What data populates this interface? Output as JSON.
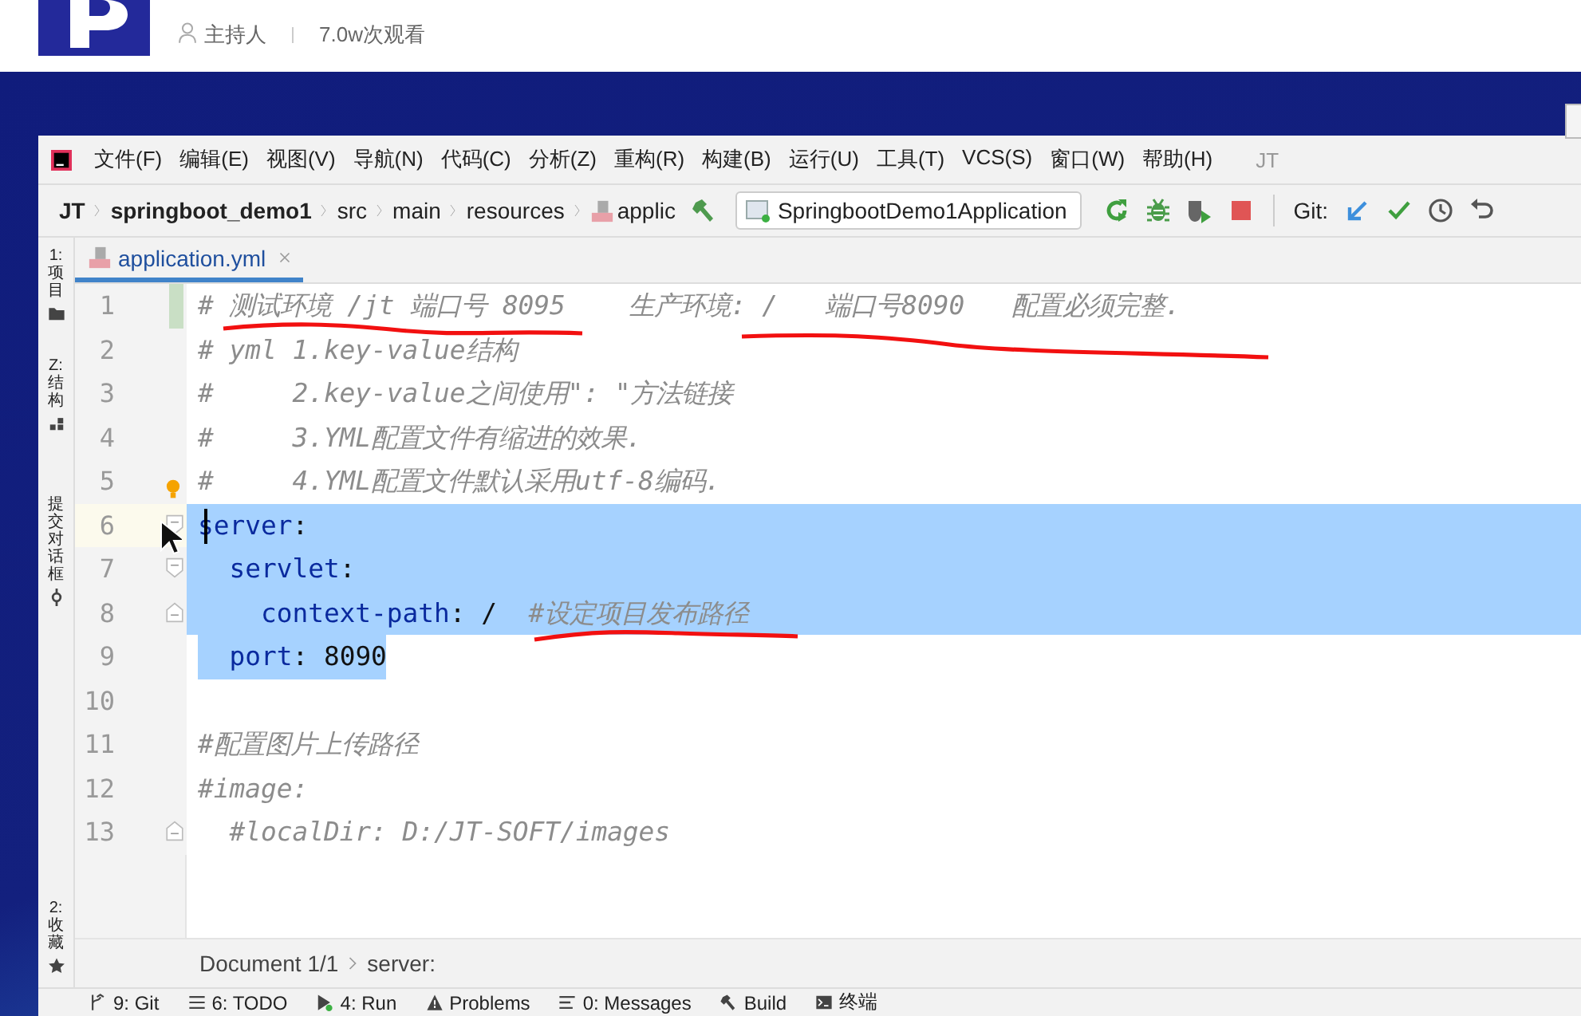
{
  "header": {
    "host": "主持人",
    "views": "7.0w次观看"
  },
  "ide": {
    "menu": [
      "文件(F)",
      "编辑(E)",
      "视图(V)",
      "导航(N)",
      "代码(C)",
      "分析(Z)",
      "重构(R)",
      "构建(B)",
      "运行(U)",
      "工具(T)",
      "VCS(S)",
      "窗口(W)",
      "帮助(H)"
    ],
    "project_title": "JT",
    "breadcrumb": [
      {
        "text": "JT",
        "bold": true,
        "kind": "plain"
      },
      {
        "text": "springboot_demo1",
        "bold": true,
        "kind": "plain"
      },
      {
        "text": "src",
        "bold": false,
        "kind": "plain"
      },
      {
        "text": "main",
        "bold": false,
        "kind": "plain"
      },
      {
        "text": "resources",
        "bold": false,
        "kind": "plain"
      },
      {
        "text": "applic",
        "bold": false,
        "kind": "yml"
      }
    ],
    "run_config": "SpringbootDemo1Application",
    "git_label": "Git:",
    "tabs": [
      {
        "label": "application.yml",
        "selected": true
      }
    ],
    "left_tools": [
      {
        "label": "1: 项目",
        "kind": "folder"
      },
      {
        "label": "Z: 结构",
        "kind": "structure"
      },
      {
        "label": "提交对话框",
        "kind": "commit"
      },
      {
        "label": "2: 收藏",
        "kind": "star"
      }
    ],
    "lines": [
      {
        "number": "1",
        "selected": false,
        "changed": true,
        "fold_open": false,
        "fold_close": false,
        "segments": [
          {
            "kind": "comment",
            "text": "# 测试环境 /jt 端口号 8095    生产环境: /   端口号8090   配置必须完整."
          }
        ]
      },
      {
        "number": "2",
        "selected": false,
        "changed": false,
        "fold_open": false,
        "fold_close": false,
        "segments": [
          {
            "kind": "comment",
            "text": "# yml 1.key-value结构"
          }
        ]
      },
      {
        "number": "3",
        "selected": false,
        "changed": false,
        "fold_open": false,
        "fold_close": false,
        "segments": [
          {
            "kind": "comment",
            "text": "#     2.key-value之间使用\": \"方法链接"
          }
        ]
      },
      {
        "number": "4",
        "selected": false,
        "changed": false,
        "fold_open": false,
        "fold_close": false,
        "segments": [
          {
            "kind": "comment",
            "text": "#     3.YML配置文件有缩进的效果."
          }
        ]
      },
      {
        "number": "5",
        "selected": false,
        "changed": false,
        "fold_open": false,
        "fold_close": false,
        "hint": true,
        "segments": [
          {
            "kind": "comment",
            "text": "#     4.YML配置文件默认采用utf-8编码."
          }
        ]
      },
      {
        "number": "6",
        "selected": true,
        "changed": false,
        "fold_open": true,
        "fold_close": false,
        "current": true,
        "segments": [
          {
            "kind": "key",
            "text": "server"
          },
          {
            "kind": "plain",
            "text": ":"
          }
        ]
      },
      {
        "number": "7",
        "selected": true,
        "changed": false,
        "fold_open": true,
        "fold_close": false,
        "segments": [
          {
            "kind": "key",
            "text": "  servlet"
          },
          {
            "kind": "plain",
            "text": ":"
          }
        ]
      },
      {
        "number": "8",
        "selected": true,
        "changed": false,
        "fold_open": false,
        "fold_close": true,
        "segments": [
          {
            "kind": "key",
            "text": "    context-path"
          },
          {
            "kind": "plain",
            "text": ": /  "
          },
          {
            "kind": "comment",
            "text": "#设定项目发布路径"
          }
        ]
      },
      {
        "number": "9",
        "selected": true,
        "changed": false,
        "fold_open": false,
        "fold_close": false,
        "segments": [
          {
            "kind": "key",
            "text": "  port"
          },
          {
            "kind": "plain",
            "text": ": 8090"
          }
        ]
      },
      {
        "number": "10",
        "selected": false,
        "changed": false,
        "fold_open": false,
        "fold_close": false
      },
      {
        "number": "11",
        "selected": false,
        "changed": false,
        "fold_open": false,
        "fold_close": false,
        "segments": [
          {
            "kind": "comment",
            "text": "#配置图片上传路径"
          }
        ]
      },
      {
        "number": "12",
        "selected": false,
        "changed": false,
        "fold_open": false,
        "fold_close": false,
        "segments": [
          {
            "kind": "comment",
            "text": "#image:"
          }
        ]
      },
      {
        "number": "13",
        "selected": false,
        "changed": false,
        "fold_open": false,
        "fold_close": true,
        "segments": [
          {
            "kind": "comment",
            "text": "  #localDir: D:/JT-SOFT/images"
          }
        ]
      }
    ],
    "status_path": [
      "Document 1/1",
      "server:"
    ],
    "bottom_tools": [
      {
        "label": "9: Git",
        "kind": "git"
      },
      {
        "label": "6: TODO",
        "kind": "todo"
      },
      {
        "label": "4: Run",
        "kind": "run"
      },
      {
        "label": "Problems",
        "kind": "problems"
      },
      {
        "label": "0: Messages",
        "kind": "messages"
      },
      {
        "label": "Build",
        "kind": "build"
      },
      {
        "label": "终端",
        "kind": "terminal"
      }
    ]
  }
}
